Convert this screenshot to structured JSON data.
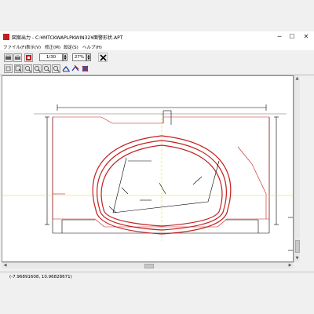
{
  "window": {
    "title": "図案出力 - C:¥MTCKWAPLPKWIN32¥面警形状.APT",
    "buttons": {
      "minimize": "─",
      "maximize": "☐",
      "close": "✕"
    }
  },
  "menu": [
    {
      "label": "ファイル(F)"
    },
    {
      "label": "表示(V)"
    },
    {
      "label": "修正(M)"
    },
    {
      "label": "設定(S)"
    },
    {
      "label": "ヘルプ(H)"
    }
  ],
  "toolbar": {
    "page_value": "1/30",
    "zoom_value": "27%"
  },
  "status": {
    "coordinates": "(-7.96891608, 10.96828671)"
  },
  "colors": {
    "accent_red": "#c21f1f",
    "guide_yellow": "#e8e000",
    "line_black": "#000000"
  },
  "icons": [
    "app-icon",
    "printer-icon",
    "print-preview-icon",
    "export-icon",
    "spin-up-icon",
    "spin-down-icon",
    "close-x-icon",
    "select-tool-icon",
    "zoom-window-icon",
    "zoom-in-icon",
    "zoom-out-icon",
    "zoom-fit-icon",
    "draw-blue-icon",
    "draw-blue-alt-icon",
    "delete-red-icon"
  ]
}
